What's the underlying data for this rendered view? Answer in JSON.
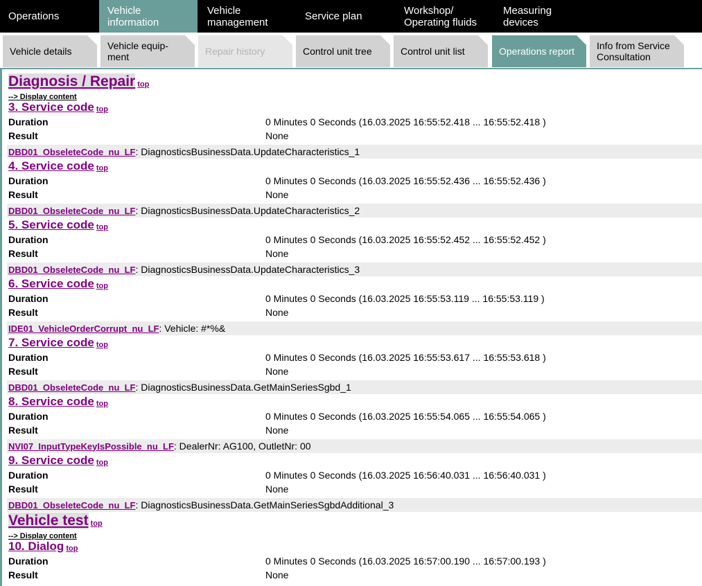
{
  "top_nav": [
    {
      "label": "Operations",
      "active": false
    },
    {
      "label": "Vehicle information",
      "active": true
    },
    {
      "label_lines": [
        "Vehicle",
        "management"
      ],
      "active": false
    },
    {
      "label": "Service plan",
      "active": false
    },
    {
      "label_lines": [
        "Workshop/",
        "Operating fluids"
      ],
      "active": false
    },
    {
      "label": "Measuring devices",
      "active": false
    }
  ],
  "sub_nav": [
    {
      "label": "Vehicle details",
      "state": "normal"
    },
    {
      "label_lines": [
        "Vehicle equip-",
        "ment"
      ],
      "state": "normal"
    },
    {
      "label": "Repair history",
      "state": "disabled"
    },
    {
      "label": "Control unit tree",
      "state": "normal"
    },
    {
      "label": "Control unit list",
      "state": "normal"
    },
    {
      "label": "Operations report",
      "state": "active"
    },
    {
      "label_lines": [
        "Info from Service",
        "Consultation"
      ],
      "state": "normal"
    }
  ],
  "report": {
    "top_label": "top",
    "display_content_label": "--> Display content",
    "duration_label": "Duration",
    "result_label": "Result",
    "groups": [
      {
        "title": "Diagnosis / Repair",
        "sections": [
          {
            "title": "3. Service code",
            "duration": "0 Minutes 0 Seconds (16.03.2025 16:55:52.418 ... 16:55:52.418 )",
            "result": "None",
            "code": "DBD01_ObseleteCode_nu_LF",
            "message": ": DiagnosticsBusinessData.UpdateCharacteristics_1"
          },
          {
            "title": "4. Service code",
            "duration": "0 Minutes 0 Seconds (16.03.2025 16:55:52.436 ... 16:55:52.436 )",
            "result": "None",
            "code": "DBD01_ObseleteCode_nu_LF",
            "message": ": DiagnosticsBusinessData.UpdateCharacteristics_2"
          },
          {
            "title": "5. Service code",
            "duration": "0 Minutes 0 Seconds (16.03.2025 16:55:52.452 ... 16:55:52.452 )",
            "result": "None",
            "code": "DBD01_ObseleteCode_nu_LF",
            "message": ": DiagnosticsBusinessData.UpdateCharacteristics_3"
          },
          {
            "title": "6. Service code",
            "duration": "0 Minutes 0 Seconds (16.03.2025 16:55:53.119 ... 16:55:53.119 )",
            "result": "None",
            "code": "IDE01_VehicleOrderCorrupt_nu_LF",
            "message": ": Vehicle: #*%&"
          },
          {
            "title": "7. Service code",
            "duration": "0 Minutes 0 Seconds (16.03.2025 16:55:53.617 ... 16:55:53.618 )",
            "result": "None",
            "code": "DBD01_ObseleteCode_nu_LF",
            "message": ": DiagnosticsBusinessData.GetMainSeriesSgbd_1"
          },
          {
            "title": "8. Service code",
            "duration": "0 Minutes 0 Seconds (16.03.2025 16:55:54.065 ... 16:55:54.065 )",
            "result": "None",
            "code": "NVI07_InputTypeKeyIsPossible_nu_LF",
            "message": ": DealerNr: AG100, OutletNr: 00"
          },
          {
            "title": "9. Service code",
            "duration": "0 Minutes 0 Seconds (16.03.2025 16:56:40.031 ... 16:56:40.031 )",
            "result": "None",
            "code": "DBD01_ObseleteCode_nu_LF",
            "message": ": DiagnosticsBusinessData.GetMainSeriesSgbdAdditional_3"
          }
        ]
      },
      {
        "title": "Vehicle test",
        "sections": [
          {
            "title": "10. Dialog",
            "duration": "0 Minutes 0 Seconds (16.03.2025 16:57:00.190 ... 16:57:00.193 )",
            "result": "None",
            "code": "",
            "message": ""
          }
        ]
      }
    ]
  }
}
